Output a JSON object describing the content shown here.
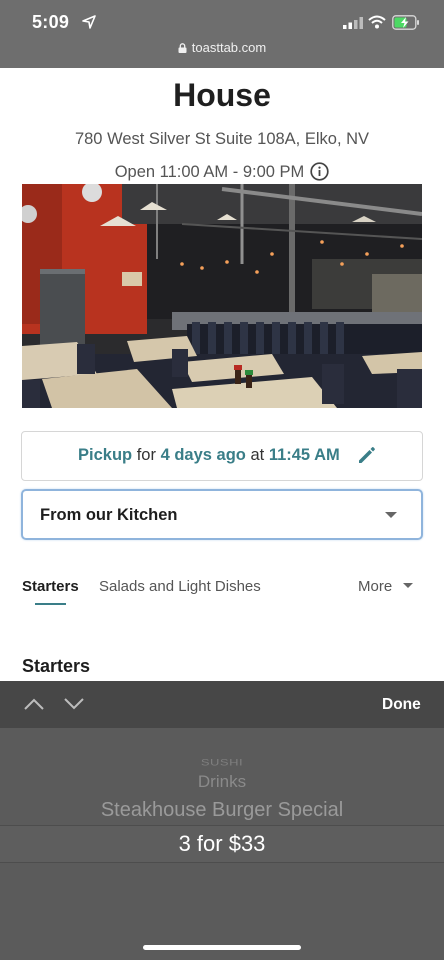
{
  "status_bar": {
    "time": "5:09",
    "url": "toasttab.com"
  },
  "restaurant": {
    "name": "House",
    "address": "780 West Silver St Suite 108A, Elko, NV",
    "hours": "Open 11:00 AM - 9:00 PM"
  },
  "pickup": {
    "mode": "Pickup",
    "for_word": "for",
    "day": "4 days ago",
    "at_word": "at",
    "time": "11:45 AM"
  },
  "menu_select": {
    "value": "From our Kitchen"
  },
  "tabs": [
    {
      "label": "Starters",
      "active": true
    },
    {
      "label": "Salads and Light Dishes",
      "active": false
    },
    {
      "label": "More",
      "active": false
    }
  ],
  "section": {
    "heading": "Starters"
  },
  "picker_toolbar": {
    "done_label": "Done"
  },
  "picker": {
    "options": [
      "SUSHI",
      "Drinks",
      "Steakhouse Burger Special",
      "3 for $33"
    ],
    "selected": "3 for $33"
  },
  "colors": {
    "accent": "#3a7e88",
    "focus_border": "#8fb4dc",
    "status_bar_bg": "#6e6e6e",
    "picker_bg": "#5b5b5b"
  }
}
